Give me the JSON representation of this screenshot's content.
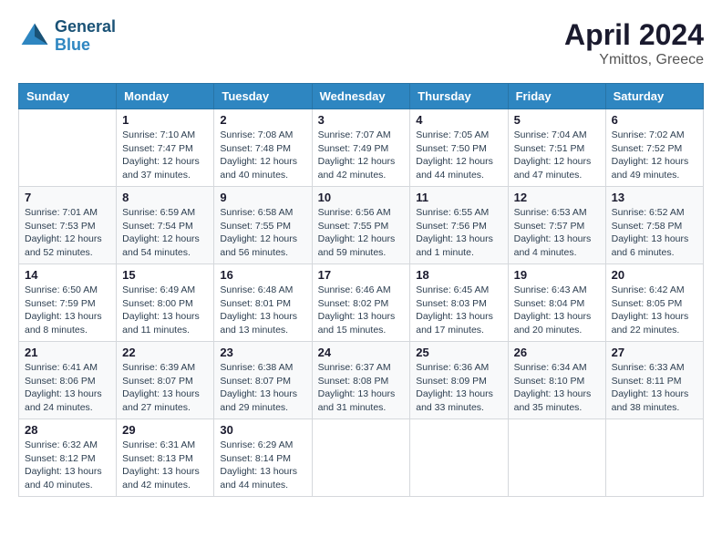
{
  "header": {
    "logo_line1": "General",
    "logo_line2": "Blue",
    "month": "April 2024",
    "location": "Ymittos, Greece"
  },
  "days_of_week": [
    "Sunday",
    "Monday",
    "Tuesday",
    "Wednesday",
    "Thursday",
    "Friday",
    "Saturday"
  ],
  "weeks": [
    [
      {
        "day": "",
        "sunrise": "",
        "sunset": "",
        "daylight": ""
      },
      {
        "day": "1",
        "sunrise": "Sunrise: 7:10 AM",
        "sunset": "Sunset: 7:47 PM",
        "daylight": "Daylight: 12 hours and 37 minutes."
      },
      {
        "day": "2",
        "sunrise": "Sunrise: 7:08 AM",
        "sunset": "Sunset: 7:48 PM",
        "daylight": "Daylight: 12 hours and 40 minutes."
      },
      {
        "day": "3",
        "sunrise": "Sunrise: 7:07 AM",
        "sunset": "Sunset: 7:49 PM",
        "daylight": "Daylight: 12 hours and 42 minutes."
      },
      {
        "day": "4",
        "sunrise": "Sunrise: 7:05 AM",
        "sunset": "Sunset: 7:50 PM",
        "daylight": "Daylight: 12 hours and 44 minutes."
      },
      {
        "day": "5",
        "sunrise": "Sunrise: 7:04 AM",
        "sunset": "Sunset: 7:51 PM",
        "daylight": "Daylight: 12 hours and 47 minutes."
      },
      {
        "day": "6",
        "sunrise": "Sunrise: 7:02 AM",
        "sunset": "Sunset: 7:52 PM",
        "daylight": "Daylight: 12 hours and 49 minutes."
      }
    ],
    [
      {
        "day": "7",
        "sunrise": "Sunrise: 7:01 AM",
        "sunset": "Sunset: 7:53 PM",
        "daylight": "Daylight: 12 hours and 52 minutes."
      },
      {
        "day": "8",
        "sunrise": "Sunrise: 6:59 AM",
        "sunset": "Sunset: 7:54 PM",
        "daylight": "Daylight: 12 hours and 54 minutes."
      },
      {
        "day": "9",
        "sunrise": "Sunrise: 6:58 AM",
        "sunset": "Sunset: 7:55 PM",
        "daylight": "Daylight: 12 hours and 56 minutes."
      },
      {
        "day": "10",
        "sunrise": "Sunrise: 6:56 AM",
        "sunset": "Sunset: 7:55 PM",
        "daylight": "Daylight: 12 hours and 59 minutes."
      },
      {
        "day": "11",
        "sunrise": "Sunrise: 6:55 AM",
        "sunset": "Sunset: 7:56 PM",
        "daylight": "Daylight: 13 hours and 1 minute."
      },
      {
        "day": "12",
        "sunrise": "Sunrise: 6:53 AM",
        "sunset": "Sunset: 7:57 PM",
        "daylight": "Daylight: 13 hours and 4 minutes."
      },
      {
        "day": "13",
        "sunrise": "Sunrise: 6:52 AM",
        "sunset": "Sunset: 7:58 PM",
        "daylight": "Daylight: 13 hours and 6 minutes."
      }
    ],
    [
      {
        "day": "14",
        "sunrise": "Sunrise: 6:50 AM",
        "sunset": "Sunset: 7:59 PM",
        "daylight": "Daylight: 13 hours and 8 minutes."
      },
      {
        "day": "15",
        "sunrise": "Sunrise: 6:49 AM",
        "sunset": "Sunset: 8:00 PM",
        "daylight": "Daylight: 13 hours and 11 minutes."
      },
      {
        "day": "16",
        "sunrise": "Sunrise: 6:48 AM",
        "sunset": "Sunset: 8:01 PM",
        "daylight": "Daylight: 13 hours and 13 minutes."
      },
      {
        "day": "17",
        "sunrise": "Sunrise: 6:46 AM",
        "sunset": "Sunset: 8:02 PM",
        "daylight": "Daylight: 13 hours and 15 minutes."
      },
      {
        "day": "18",
        "sunrise": "Sunrise: 6:45 AM",
        "sunset": "Sunset: 8:03 PM",
        "daylight": "Daylight: 13 hours and 17 minutes."
      },
      {
        "day": "19",
        "sunrise": "Sunrise: 6:43 AM",
        "sunset": "Sunset: 8:04 PM",
        "daylight": "Daylight: 13 hours and 20 minutes."
      },
      {
        "day": "20",
        "sunrise": "Sunrise: 6:42 AM",
        "sunset": "Sunset: 8:05 PM",
        "daylight": "Daylight: 13 hours and 22 minutes."
      }
    ],
    [
      {
        "day": "21",
        "sunrise": "Sunrise: 6:41 AM",
        "sunset": "Sunset: 8:06 PM",
        "daylight": "Daylight: 13 hours and 24 minutes."
      },
      {
        "day": "22",
        "sunrise": "Sunrise: 6:39 AM",
        "sunset": "Sunset: 8:07 PM",
        "daylight": "Daylight: 13 hours and 27 minutes."
      },
      {
        "day": "23",
        "sunrise": "Sunrise: 6:38 AM",
        "sunset": "Sunset: 8:07 PM",
        "daylight": "Daylight: 13 hours and 29 minutes."
      },
      {
        "day": "24",
        "sunrise": "Sunrise: 6:37 AM",
        "sunset": "Sunset: 8:08 PM",
        "daylight": "Daylight: 13 hours and 31 minutes."
      },
      {
        "day": "25",
        "sunrise": "Sunrise: 6:36 AM",
        "sunset": "Sunset: 8:09 PM",
        "daylight": "Daylight: 13 hours and 33 minutes."
      },
      {
        "day": "26",
        "sunrise": "Sunrise: 6:34 AM",
        "sunset": "Sunset: 8:10 PM",
        "daylight": "Daylight: 13 hours and 35 minutes."
      },
      {
        "day": "27",
        "sunrise": "Sunrise: 6:33 AM",
        "sunset": "Sunset: 8:11 PM",
        "daylight": "Daylight: 13 hours and 38 minutes."
      }
    ],
    [
      {
        "day": "28",
        "sunrise": "Sunrise: 6:32 AM",
        "sunset": "Sunset: 8:12 PM",
        "daylight": "Daylight: 13 hours and 40 minutes."
      },
      {
        "day": "29",
        "sunrise": "Sunrise: 6:31 AM",
        "sunset": "Sunset: 8:13 PM",
        "daylight": "Daylight: 13 hours and 42 minutes."
      },
      {
        "day": "30",
        "sunrise": "Sunrise: 6:29 AM",
        "sunset": "Sunset: 8:14 PM",
        "daylight": "Daylight: 13 hours and 44 minutes."
      },
      {
        "day": "",
        "sunrise": "",
        "sunset": "",
        "daylight": ""
      },
      {
        "day": "",
        "sunrise": "",
        "sunset": "",
        "daylight": ""
      },
      {
        "day": "",
        "sunrise": "",
        "sunset": "",
        "daylight": ""
      },
      {
        "day": "",
        "sunrise": "",
        "sunset": "",
        "daylight": ""
      }
    ]
  ]
}
